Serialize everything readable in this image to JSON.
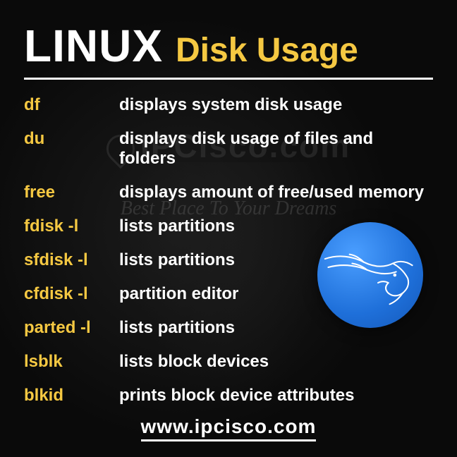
{
  "header": {
    "title_main": "LINUX",
    "title_sub": "Disk Usage"
  },
  "watermark": {
    "text": "IPCisco.com",
    "tagline": "Best Place To Your Dreams"
  },
  "commands": [
    {
      "name": "df",
      "desc": "displays system disk usage"
    },
    {
      "name": "du",
      "desc": "displays disk usage of files and folders"
    },
    {
      "name": "free",
      "desc": "displays amount of free/used memory"
    },
    {
      "name": "fdisk -l",
      "desc": "lists partitions"
    },
    {
      "name": "sfdisk -l",
      "desc": "lists partitions"
    },
    {
      "name": "cfdisk -l",
      "desc": "partition editor"
    },
    {
      "name": "parted -l",
      "desc": "lists partitions"
    },
    {
      "name": "lsblk",
      "desc": "lists block devices"
    },
    {
      "name": "blkid",
      "desc": "prints block device attributes"
    }
  ],
  "footer": {
    "url": "www.ipcisco.com"
  },
  "colors": {
    "accent": "#f5c842",
    "text": "#ffffff",
    "badge": "#1e6fd9"
  }
}
